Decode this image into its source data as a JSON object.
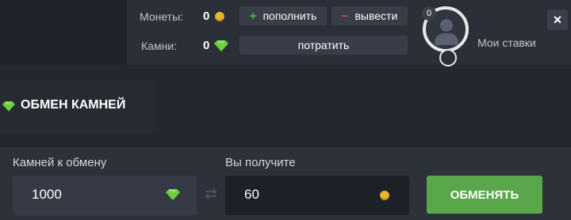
{
  "header": {
    "coins_label": "Монеты:",
    "coins_value": "0",
    "gems_label": "Камни:",
    "gems_value": "0",
    "deposit_label": "пополнить",
    "deposit_icon": "+",
    "withdraw_label": "вывести",
    "withdraw_icon": "−",
    "spend_label": "потратить",
    "level": "0",
    "my_bets": "Мои ставки",
    "close": "×"
  },
  "exchange": {
    "title": "ОБМЕН КАМНЕЙ",
    "gems_to_exchange_label": "Камней к обмену",
    "gems_to_exchange_value": "1000",
    "you_receive_label": "Вы получите",
    "you_receive_value": "60",
    "button_label": "ОБМЕНЯТЬ"
  },
  "icons": {
    "coin": "coin-icon",
    "gem": "gem-icon",
    "swap": "swap-arrows-icon",
    "avatar": "user-avatar-icon",
    "close": "close-icon"
  },
  "colors": {
    "accent_green": "#5aa64a",
    "gem_green": "#6ccf3c",
    "coin_gold": "#e9b52b",
    "plus_green": "#4bc04b",
    "minus_red": "#e0443c"
  }
}
